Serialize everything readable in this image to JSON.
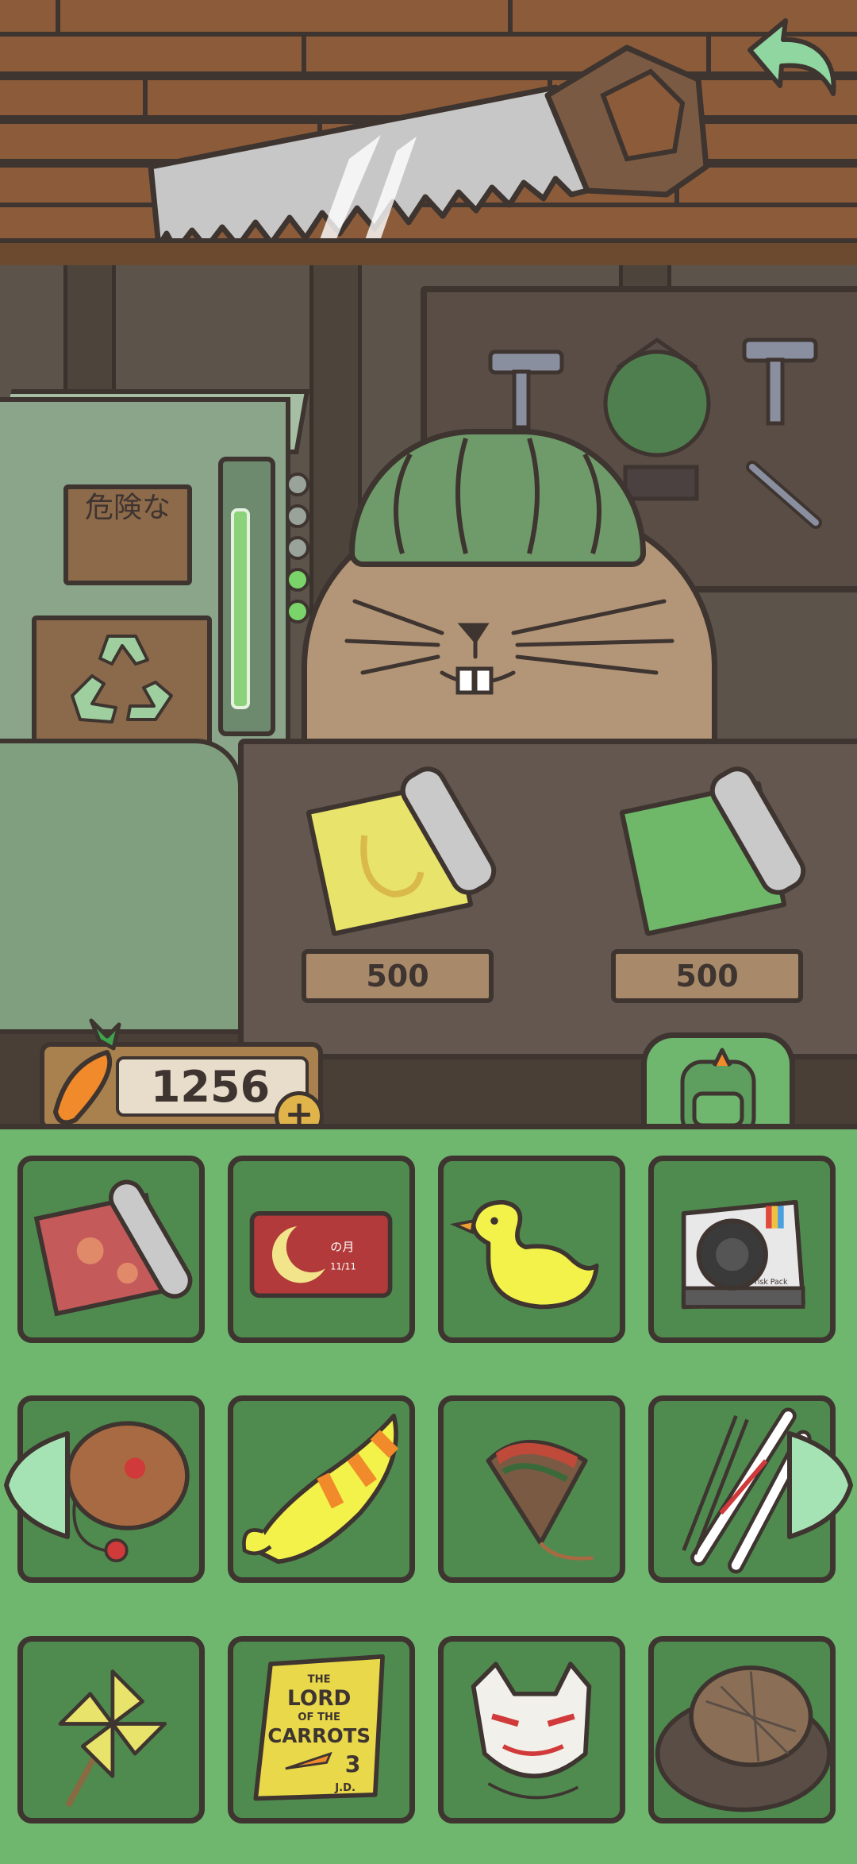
{
  "shop": {
    "items_for_sale": [
      {
        "name": "banana-scroll",
        "price": "500",
        "color": "#e8e36a"
      },
      {
        "name": "leaf-scroll",
        "price": "500",
        "color": "#6fb86a"
      }
    ],
    "sign_text": "危険な"
  },
  "carrots": {
    "count": "1256",
    "add_label": "+"
  },
  "inventory": {
    "items": [
      {
        "name": "red-pattern-scroll",
        "icon": "scroll-icon"
      },
      {
        "name": "moon-postcard",
        "icon": "postcard-icon",
        "text_line1": "の月",
        "text_line2": "11/11"
      },
      {
        "name": "rubber-duck",
        "icon": "duck-icon"
      },
      {
        "name": "instant-camera",
        "icon": "camera-icon",
        "brand": "Frisk Pack"
      },
      {
        "name": "kendama",
        "icon": "kendama-icon"
      },
      {
        "name": "duck-swim-ring",
        "icon": "swim-ring-icon"
      },
      {
        "name": "spinning-top",
        "icon": "spinning-top-icon"
      },
      {
        "name": "skis-and-poles",
        "icon": "ski-icon"
      },
      {
        "name": "pinwheel",
        "icon": "pinwheel-icon"
      },
      {
        "name": "lord-of-the-carrots-book",
        "icon": "book-icon",
        "title_line1": "THE",
        "title_line2": "LORD",
        "title_line3": "OF THE",
        "title_line4": "CARROTS",
        "volume": "3",
        "author": "J.D."
      },
      {
        "name": "fox-mask",
        "icon": "mask-icon"
      },
      {
        "name": "straw-hat",
        "icon": "hat-icon"
      }
    ]
  },
  "colors": {
    "panel_green": "#6fb66f",
    "slot_green": "#4f8a4f",
    "outline": "#3e3430",
    "arrow_green": "#a6e3b4"
  }
}
